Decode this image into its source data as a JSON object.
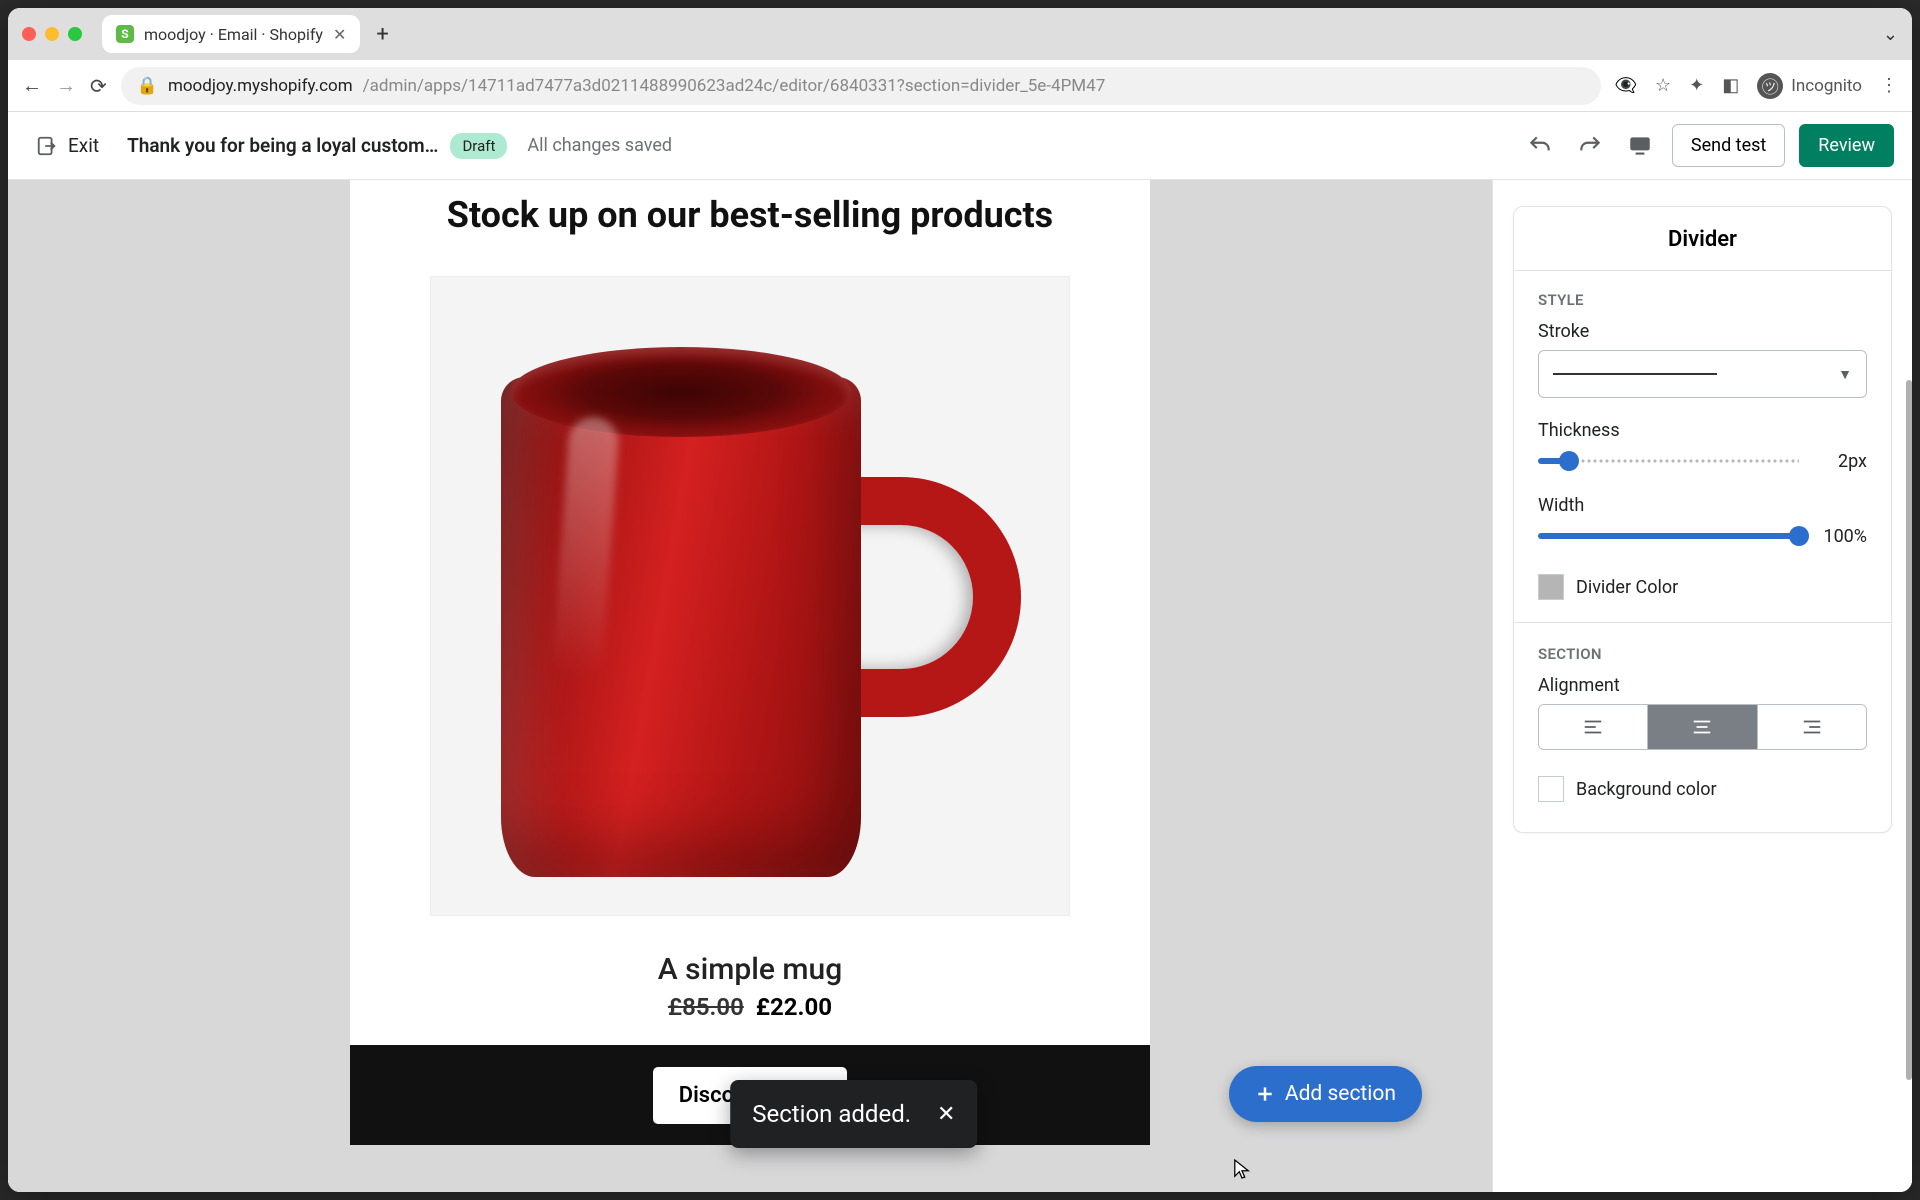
{
  "browser": {
    "tab_title": "moodjoy · Email · Shopify",
    "url_host": "moodjoy.myshopify.com",
    "url_path": "/admin/apps/14711ad7477a3d0211488990623ad24c/editor/6840331?section=divider_5e-4PM47",
    "incognito_label": "Incognito"
  },
  "appbar": {
    "exit_label": "Exit",
    "page_title": "Thank you for being a loyal custom…",
    "draft_badge": "Draft",
    "saved_text": "All changes saved",
    "send_test": "Send test",
    "review": "Review"
  },
  "canvas": {
    "headline": "Stock up on our best-selling products",
    "product_title": "A simple mug",
    "price_original": "£85.00",
    "price_current": "£22.00",
    "discover_label": "Discover More"
  },
  "toast": {
    "message": "Section added."
  },
  "add_section_label": "Add section",
  "panel": {
    "title": "Divider",
    "style_header": "STYLE",
    "stroke_label": "Stroke",
    "thickness_label": "Thickness",
    "thickness_value": "2px",
    "thickness_percent": 12,
    "width_label": "Width",
    "width_value": "100%",
    "width_percent": 100,
    "divider_color_label": "Divider Color",
    "section_header": "SECTION",
    "alignment_label": "Alignment",
    "alignment_selected": "center",
    "bg_color_label": "Background color"
  }
}
